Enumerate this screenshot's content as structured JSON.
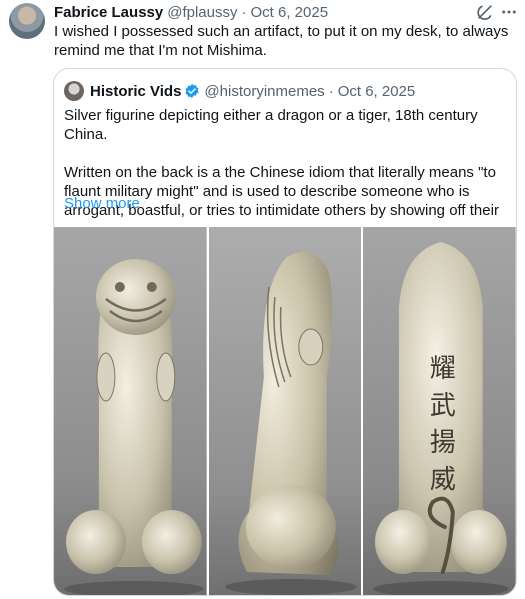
{
  "tweet": {
    "author_name": "Fabrice Laussy",
    "author_handle": "@fplaussy",
    "separator": "·",
    "date": "Oct 6, 2025",
    "text": "I wished I possessed such an artifact, to put it on my desk, to always remind me that I'm not Mishima.",
    "icons": [
      "grok-icon",
      "more-icon"
    ]
  },
  "quote": {
    "author_name": "Historic Vids",
    "author_handle": "@historyinmemes",
    "separator": "·",
    "date": "Oct 6, 2025",
    "paragraph1": "Silver figurine depicting either a dragon or a tiger, 18th century China.",
    "paragraph2": "Written on the back is a the Chinese idiom that literally means \"to flaunt military might\" and is used to describe someone who is arrogant, boastful, or tries to intimidate others by showing off their",
    "show_more": "Show more",
    "engraving": [
      "耀",
      "武",
      "揚",
      "威"
    ],
    "colors": {
      "link": "#1d9bf0",
      "verified": "#1d9bf0",
      "secondary_text": "#536471",
      "border": "#cfd9de"
    }
  }
}
